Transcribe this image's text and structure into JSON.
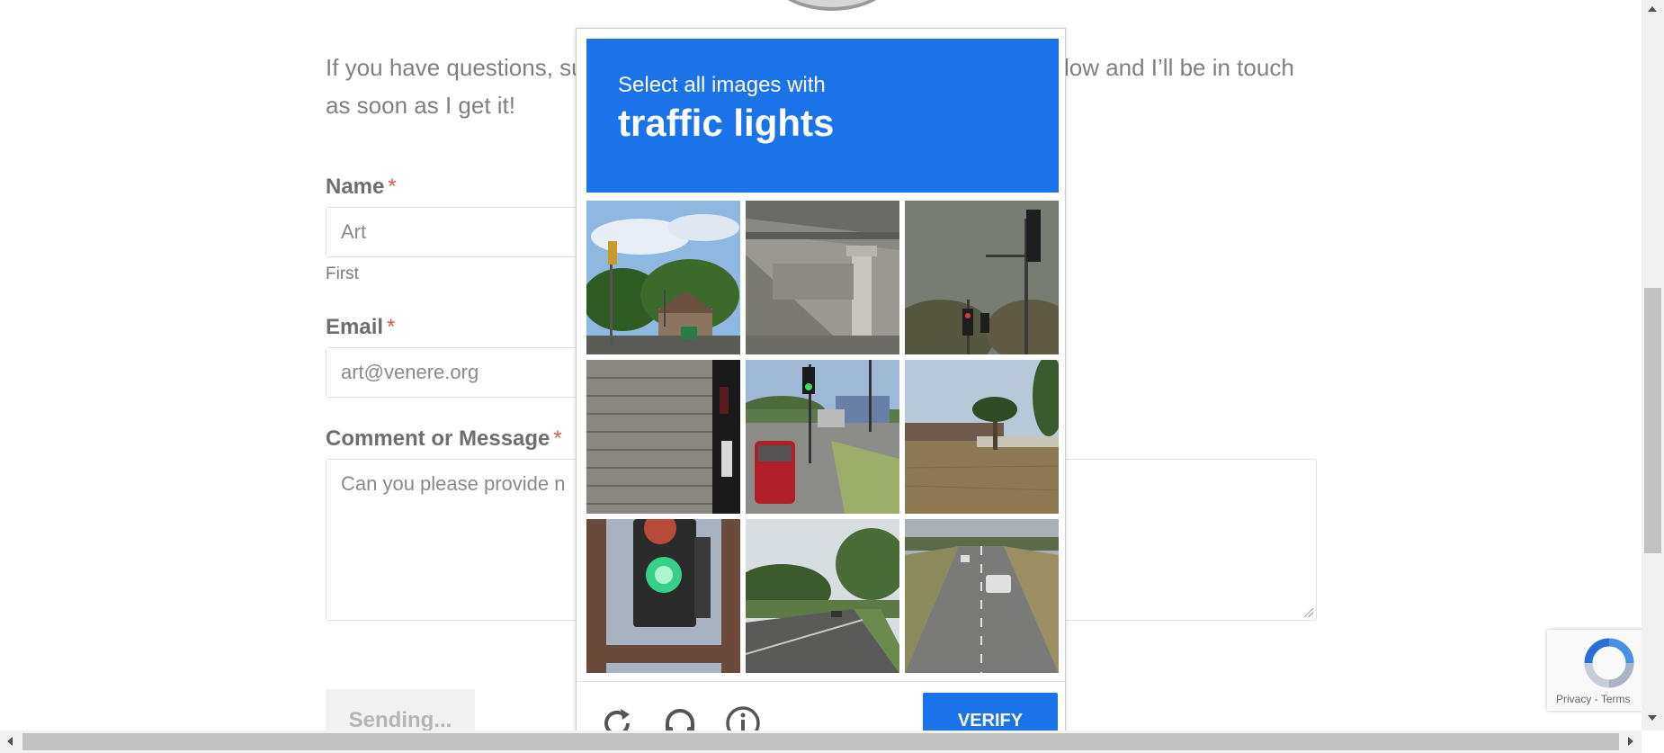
{
  "page": {
    "intro_text": "If you have questions, suggestions, or feedback please use the form below and I’ll be in touch as soon as I get it!",
    "name_label": "Name",
    "required_mark": "*",
    "name_value": "Art",
    "name_sublabel": "First",
    "email_label": "Email",
    "email_value": "art@venere.org",
    "message_label": "Comment or Message",
    "message_value": "Can you please provide n",
    "submit_label": "Sending..."
  },
  "captcha": {
    "prompt_prefix": "Select all images with",
    "prompt_keyword": "traffic lights",
    "verify_label": "VERIFY",
    "tiles": [
      {
        "name": "tile-1",
        "content": "traffic light by trees"
      },
      {
        "name": "tile-2",
        "content": "overpass"
      },
      {
        "name": "tile-3",
        "content": "traffic light pole"
      },
      {
        "name": "tile-4",
        "content": "brick wall"
      },
      {
        "name": "tile-5",
        "content": "intersection with traffic light"
      },
      {
        "name": "tile-6",
        "content": "palm trees"
      },
      {
        "name": "tile-7",
        "content": "green traffic light close-up"
      },
      {
        "name": "tile-8",
        "content": "suburban road"
      },
      {
        "name": "tile-9",
        "content": "highway"
      }
    ],
    "footer_icons": [
      "reload-icon",
      "audio-icon",
      "info-icon"
    ],
    "accent_color": "#1a73e8"
  },
  "recaptcha_badge": {
    "privacy_label": "Privacy",
    "separator": "-",
    "terms_label": "Terms"
  }
}
